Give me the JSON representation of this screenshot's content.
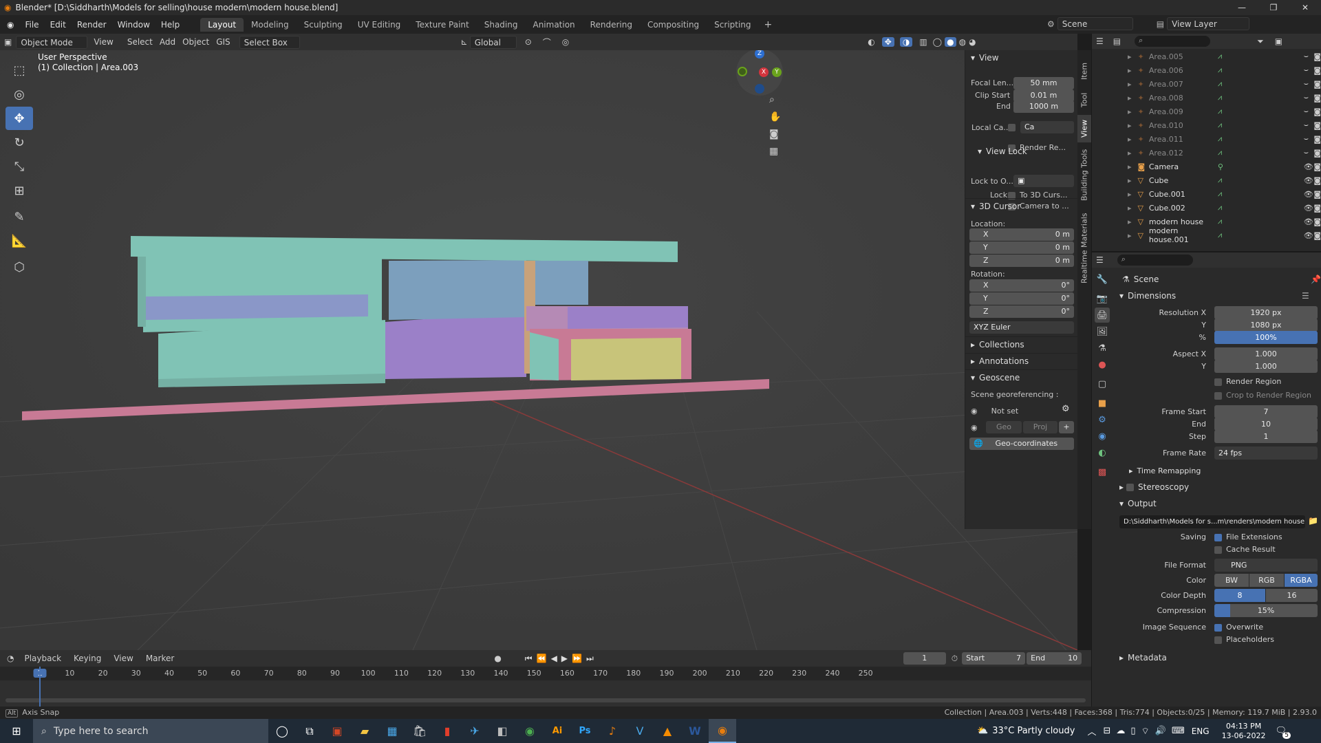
{
  "titlebar": {
    "title": "Blender* [D:\\Siddharth\\Models for selling\\house modern\\modern house.blend]"
  },
  "menu": {
    "items": [
      "File",
      "Edit",
      "Render",
      "Window",
      "Help"
    ]
  },
  "workspaces": [
    "Layout",
    "Modeling",
    "Sculpting",
    "UV Editing",
    "Texture Paint",
    "Shading",
    "Animation",
    "Rendering",
    "Compositing",
    "Scripting"
  ],
  "scene_selector": "Scene",
  "view_layer": "View Layer",
  "header": {
    "mode": "Object Mode",
    "items": [
      "View",
      "Select",
      "Add",
      "Object",
      "GIS"
    ],
    "select_box": "Select Box",
    "orientation": "Global"
  },
  "viewport": {
    "perspective": "User Perspective",
    "collection": "(1) Collection | Area.003",
    "gizmo": {
      "x": "X",
      "y": "Y",
      "z": "Z"
    }
  },
  "npanel": {
    "view_title": "View",
    "focal_label": "Focal Len...",
    "focal_value": "50 mm",
    "clip_start_label": "Clip Start",
    "clip_start_value": "0.01 m",
    "clip_end_label": "End",
    "clip_end_value": "1000 m",
    "local_cam_label": "Local Ca...",
    "local_cam_value": "Ca",
    "render_region_label": "Render Re...",
    "view_lock_title": "View Lock",
    "lock_to_label": "Lock to O...",
    "lock_label": "Lock",
    "to_3d_cursor": "To 3D Curs...",
    "camera_to": "Camera to ...",
    "cursor_title": "3D Cursor",
    "location_label": "Location:",
    "loc_x": "0 m",
    "loc_y": "0 m",
    "loc_z": "0 m",
    "rotation_label": "Rotation:",
    "rot_x": "0°",
    "rot_y": "0°",
    "rot_z": "0°",
    "rot_mode": "XYZ Euler",
    "collections": "Collections",
    "annotations": "Annotations",
    "geoscene": "Geoscene",
    "georef_label": "Scene georeferencing :",
    "not_set": "Not set",
    "geo": "Geo",
    "proj": "Proj",
    "geo_coords": "Geo-coordinates",
    "axis_x": "X",
    "axis_y": "Y",
    "axis_z": "Z"
  },
  "vtabs": [
    "Item",
    "Tool",
    "View",
    "Building Tools",
    "Realtime Materials"
  ],
  "timeline": {
    "menu": [
      "Playback",
      "Keying",
      "View",
      "Marker"
    ],
    "current_frame": "1",
    "start_label": "Start",
    "start": "7",
    "end_label": "End",
    "end": "10",
    "ticks": [
      "1",
      "10",
      "20",
      "30",
      "40",
      "50",
      "60",
      "70",
      "80",
      "90",
      "100",
      "110",
      "120",
      "130",
      "140",
      "150",
      "160",
      "170",
      "180",
      "190",
      "200",
      "210",
      "220",
      "230",
      "240",
      "250"
    ]
  },
  "statusbar": {
    "left": "Axis Snap",
    "right": "Collection | Area.003 | Verts:448 | Faces:368 | Tris:774 | Objects:0/25 | Memory: 119.7 MiB | 2.93.0"
  },
  "outliner": {
    "rows": [
      {
        "name": "Area.005",
        "type": "light",
        "visible": false
      },
      {
        "name": "Area.006",
        "type": "light",
        "visible": false
      },
      {
        "name": "Area.007",
        "type": "light",
        "visible": false
      },
      {
        "name": "Area.008",
        "type": "light",
        "visible": false
      },
      {
        "name": "Area.009",
        "type": "light",
        "visible": false
      },
      {
        "name": "Area.010",
        "type": "light",
        "visible": false
      },
      {
        "name": "Area.011",
        "type": "light",
        "visible": false
      },
      {
        "name": "Area.012",
        "type": "light",
        "visible": false
      },
      {
        "name": "Camera",
        "type": "camera",
        "visible": true
      },
      {
        "name": "Cube",
        "type": "mesh",
        "visible": true
      },
      {
        "name": "Cube.001",
        "type": "mesh",
        "visible": true
      },
      {
        "name": "Cube.002",
        "type": "mesh",
        "visible": true
      },
      {
        "name": "modern house",
        "type": "mesh",
        "visible": true
      },
      {
        "name": "modern house.001",
        "type": "mesh",
        "visible": true
      }
    ]
  },
  "properties": {
    "scene": "Scene",
    "dimensions": "Dimensions",
    "res_x_label": "Resolution X",
    "res_x": "1920 px",
    "res_y_label": "Y",
    "res_y": "1080 px",
    "pct_label": "%",
    "pct": "100%",
    "aspect_x_label": "Aspect X",
    "aspect_x": "1.000",
    "aspect_y_label": "Y",
    "aspect_y": "1.000",
    "render_region": "Render Region",
    "crop": "Crop to Render Region",
    "frame_start_label": "Frame Start",
    "frame_start": "7",
    "end_label": "End",
    "end": "10",
    "step_label": "Step",
    "step": "1",
    "frame_rate_label": "Frame Rate",
    "frame_rate": "24 fps",
    "time_remapping": "Time Remapping",
    "stereoscopy": "Stereoscopy",
    "output": "Output",
    "output_path": "D:\\Siddharth\\Models for s...m\\renders\\modern house",
    "saving_label": "Saving",
    "file_ext": "File Extensions",
    "cache_result": "Cache Result",
    "file_format_label": "File Format",
    "file_format": "PNG",
    "color_label": "Color",
    "bw": "BW",
    "rgb": "RGB",
    "rgba": "RGBA",
    "depth_label": "Color Depth",
    "depth8": "8",
    "depth16": "16",
    "compression_label": "Compression",
    "compression": "15%",
    "image_seq_label": "Image Sequence",
    "overwrite": "Overwrite",
    "placeholders": "Placeholders",
    "metadata": "Metadata"
  },
  "taskbar": {
    "search": "Type here to search",
    "weather": "33°C  Partly cloudy",
    "lang": "ENG",
    "time": "04:13 PM",
    "date": "13-06-2022",
    "notif": "5"
  }
}
